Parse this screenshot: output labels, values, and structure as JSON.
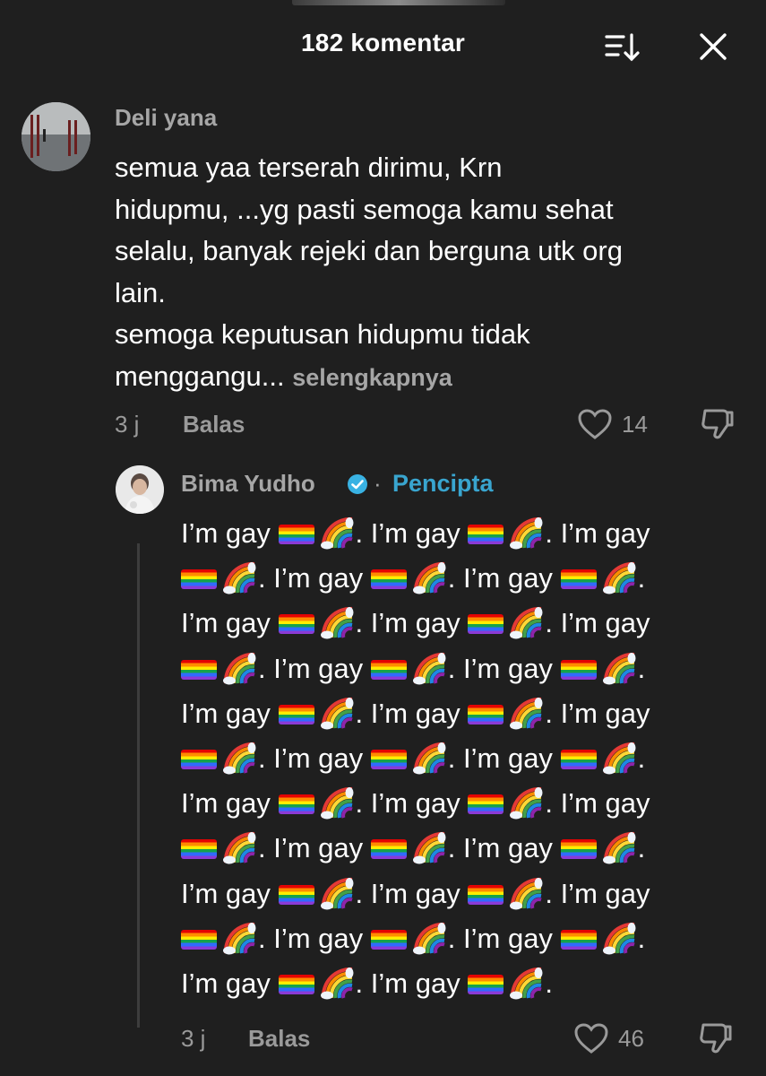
{
  "header": {
    "title": "182 komentar",
    "sort_icon": "sort-descending-icon",
    "close_icon": "close-icon"
  },
  "comments": [
    {
      "username": "Deli yana",
      "lines": [
        "semua yaa terserah dirimu, Krn",
        "hidupmu, ...yg pasti semoga kamu sehat",
        "selalu, banyak rejeki dan berguna utk org",
        "lain.",
        "semoga keputusan hidupmu tidak",
        "menggangu..."
      ],
      "see_more": "selengkapnya",
      "time": "3 j",
      "reply_label": "Balas",
      "likes": "14"
    },
    {
      "username": "Bima Yudho",
      "separator": "·",
      "creator_label": "Pencipta",
      "verified_icon": "verified-badge-icon",
      "phrase": "I’m gay",
      "emoji_names": [
        "rainbow-flag-icon",
        "rainbow-icon"
      ],
      "time": "3 j",
      "reply_label": "Balas",
      "likes": "46"
    }
  ],
  "colors": {
    "background": "#1f1f1f",
    "text": "#ffffff",
    "muted": "#9a9a9a",
    "creator": "#39a5cf"
  }
}
